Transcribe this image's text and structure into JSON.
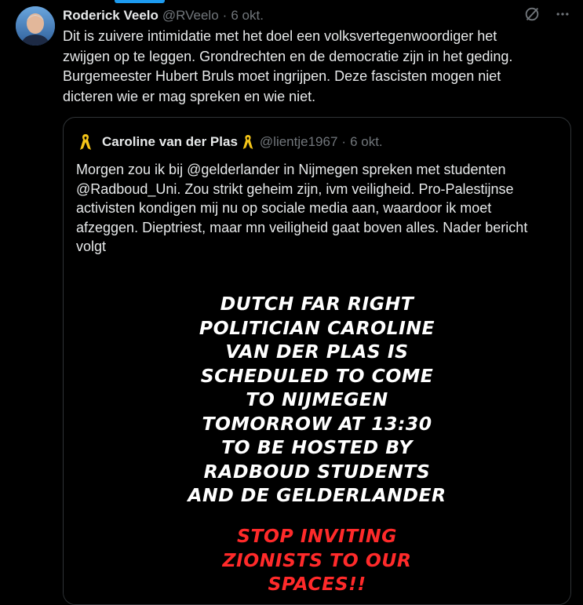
{
  "tweet": {
    "author_name": "Roderick Veelo",
    "author_handle": "@RVeelo",
    "separator": "·",
    "time": "6 okt.",
    "text": "Dit is zuivere intimidatie met het doel een volksvertegenwoordiger het\nzwijgen op te leggen. Grondrechten en de democratie zijn in het geding.\nBurgemeester Hubert Bruls moet ingrijpen. Deze fascisten mogen niet\ndicteren wie er mag spreken en wie niet."
  },
  "quote": {
    "author_name": "Caroline van der Plas",
    "author_handle": "@lientje1967",
    "separator": "·",
    "time": "6 okt.",
    "text": "Morgen zou ik bij @gelderlander in Nijmegen spreken met studenten\n@Radboud_Uni. Zou strikt geheim zijn, ivm veiligheid. Pro-Palestijnse\nactivisten kondigen mij nu op sociale media aan, waardoor ik moet\nafzeggen. Dieptriest, maar mn veiligheid gaat boven alles. Nader bericht\nvolgt",
    "media": {
      "white_lines": [
        "DUTCH FAR RIGHT",
        "POLITICIAN CAROLINE",
        "VAN DER PLAS IS",
        "SCHEDULED TO COME",
        "TO NIJMEGEN",
        "TOMORROW AT 13:30",
        "TO BE HOSTED BY",
        "RADBOUD STUDENTS",
        "AND DE GELDERLANDER"
      ],
      "red_lines": [
        "STOP INVITING",
        "ZIONISTS TO OUR",
        "SPACES!!"
      ]
    }
  },
  "icons": {
    "grok": "grok-icon",
    "more": "more-icon",
    "ribbon": "yellow-ribbon-icon"
  },
  "colors": {
    "background": "#000000",
    "text": "#e7e9ea",
    "muted": "#71767b",
    "accent": "#1d9bf0",
    "border": "#2f3336",
    "poster_red": "#ff2a2a",
    "ribbon": "#f5c518"
  }
}
